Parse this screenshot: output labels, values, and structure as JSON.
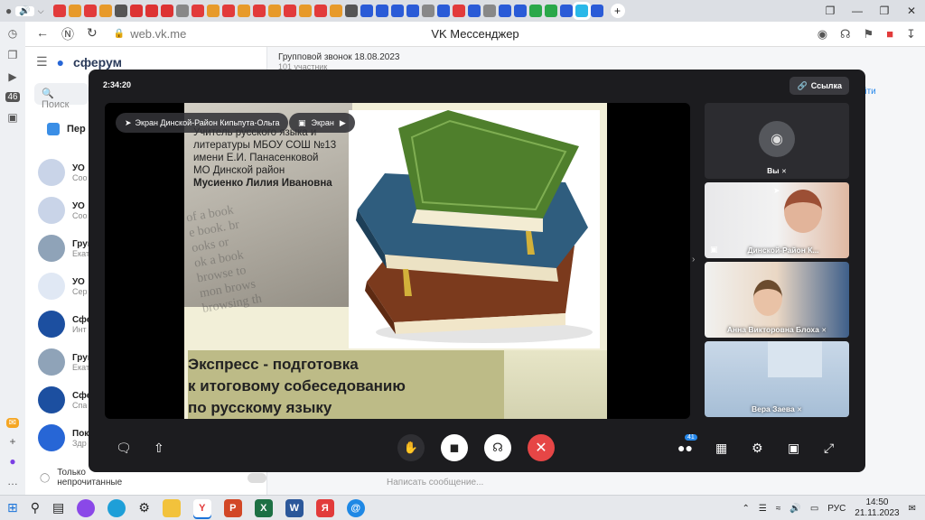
{
  "browser": {
    "page_title": "VK Мессенджер",
    "url": "web.vk.me",
    "tab_icon_colors": [
      "#e23b3b",
      "#e79a2a",
      "#e23b3b",
      "#e79a2a",
      "#555",
      "#d33",
      "#d33",
      "#d33",
      "#888",
      "#e23b3b",
      "#e79a2a",
      "#e23b3b",
      "#e79a2a",
      "#e23b3b",
      "#e79a2a",
      "#e23b3b",
      "#e79a2a",
      "#e23b3b",
      "#e79a2a",
      "#555",
      "#2a5bd7",
      "#2a5bd7",
      "#2a5bd7",
      "#2a5bd7",
      "#888",
      "#2a5bd7",
      "#e23b3b",
      "#2a5bd7",
      "#888",
      "#2a5bd7",
      "#2a5bd7",
      "#2aa84a",
      "#2aa84a",
      "#2a5bd7",
      "#2ab8e8",
      "#2a5bd7"
    ],
    "sidebar_badge": "46"
  },
  "vk": {
    "brand": "сферум",
    "search_placeholder": "Поиск",
    "chats": [
      {
        "title": "УО",
        "snippet": "Соо",
        "color": "#c9d4e8"
      },
      {
        "title": "УО",
        "snippet": "Соо",
        "color": "#c9d4e8"
      },
      {
        "title": "Груп",
        "snippet": "Екат",
        "color": "#8fa3b8"
      },
      {
        "title": "УО",
        "snippet": "Сер",
        "color": "#e0e8f4"
      },
      {
        "title": "Сфе",
        "snippet": "Инт",
        "color": "#1c4fa0"
      },
      {
        "title": "Груп",
        "snippet": "Екат",
        "color": "#8fa3b8"
      },
      {
        "title": "Сфе",
        "snippet": "Спа",
        "color": "#1c4fa0"
      },
      {
        "title": "Пок",
        "snippet": "Здр",
        "color": "#2766d6"
      }
    ],
    "section_label": "Пер",
    "filter_label": "Только непрочитанные",
    "header_title": "Групповой звонок 18.08.2023",
    "header_sub": "101 участник",
    "join_label": "йти",
    "message_placeholder": "Написать сообщение..."
  },
  "call": {
    "timer": "2:34:20",
    "link_label": "Ссылка",
    "screen_chip": "Экран Динской-Район Кипьпута-Ольга",
    "screen_chip2": "Экран",
    "slide": {
      "author_lines": [
        "Учитель русского языка и",
        "литературы МБОУ СОШ №13",
        "имени Е.И. Панасенковой",
        "МО Динской район"
      ],
      "author_name": "Мусиенко Лилия Ивановна",
      "newsprint": [
        "of a book",
        "e book. br",
        "ooks or",
        "ok a book",
        "browse to",
        "mon brows",
        "browsing th"
      ],
      "heading_lines": [
        "Экспресс - подготовка",
        "к итоговому собеседованию",
        "по русскому языку"
      ]
    },
    "participants": [
      {
        "name": "Вы"
      },
      {
        "name": "Динской-Район К..."
      },
      {
        "name": "Анна Викторовна Блоха"
      },
      {
        "name": "Вера Заева"
      }
    ],
    "participants_badge": "41"
  },
  "taskbar": {
    "lang": "РУС",
    "time": "14:50",
    "date": "21.11.2023"
  }
}
